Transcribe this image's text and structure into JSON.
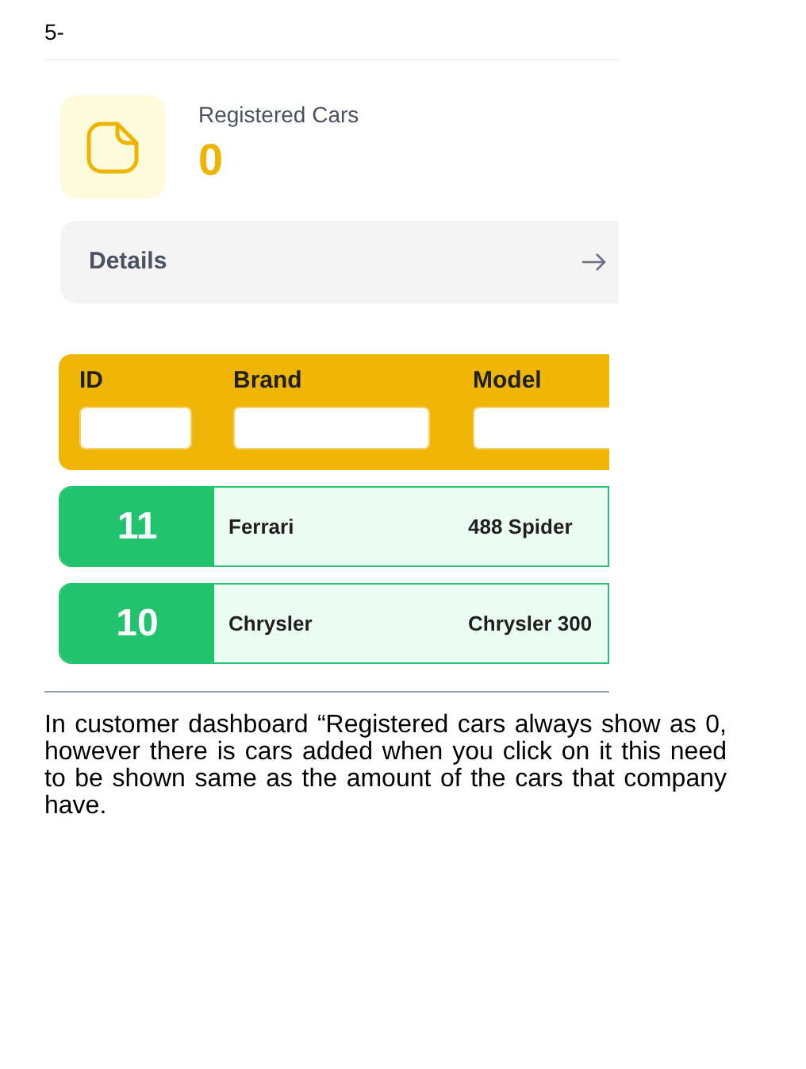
{
  "heading": "5-",
  "stat_card": {
    "title": "Registered Cars",
    "value": "0",
    "link": "Details"
  },
  "table": {
    "columns": [
      "ID",
      "Brand",
      "Model"
    ],
    "rows": [
      {
        "id": "11",
        "brand": "Ferrari",
        "model": "488 Spider"
      },
      {
        "id": "10",
        "brand": "Chrysler",
        "model": "Chrysler 300"
      }
    ]
  },
  "note": "In customer dashboard “Registered cars always show as 0, however there is cars added when you click on it this need to be shown same as the amount of the cars that company have."
}
